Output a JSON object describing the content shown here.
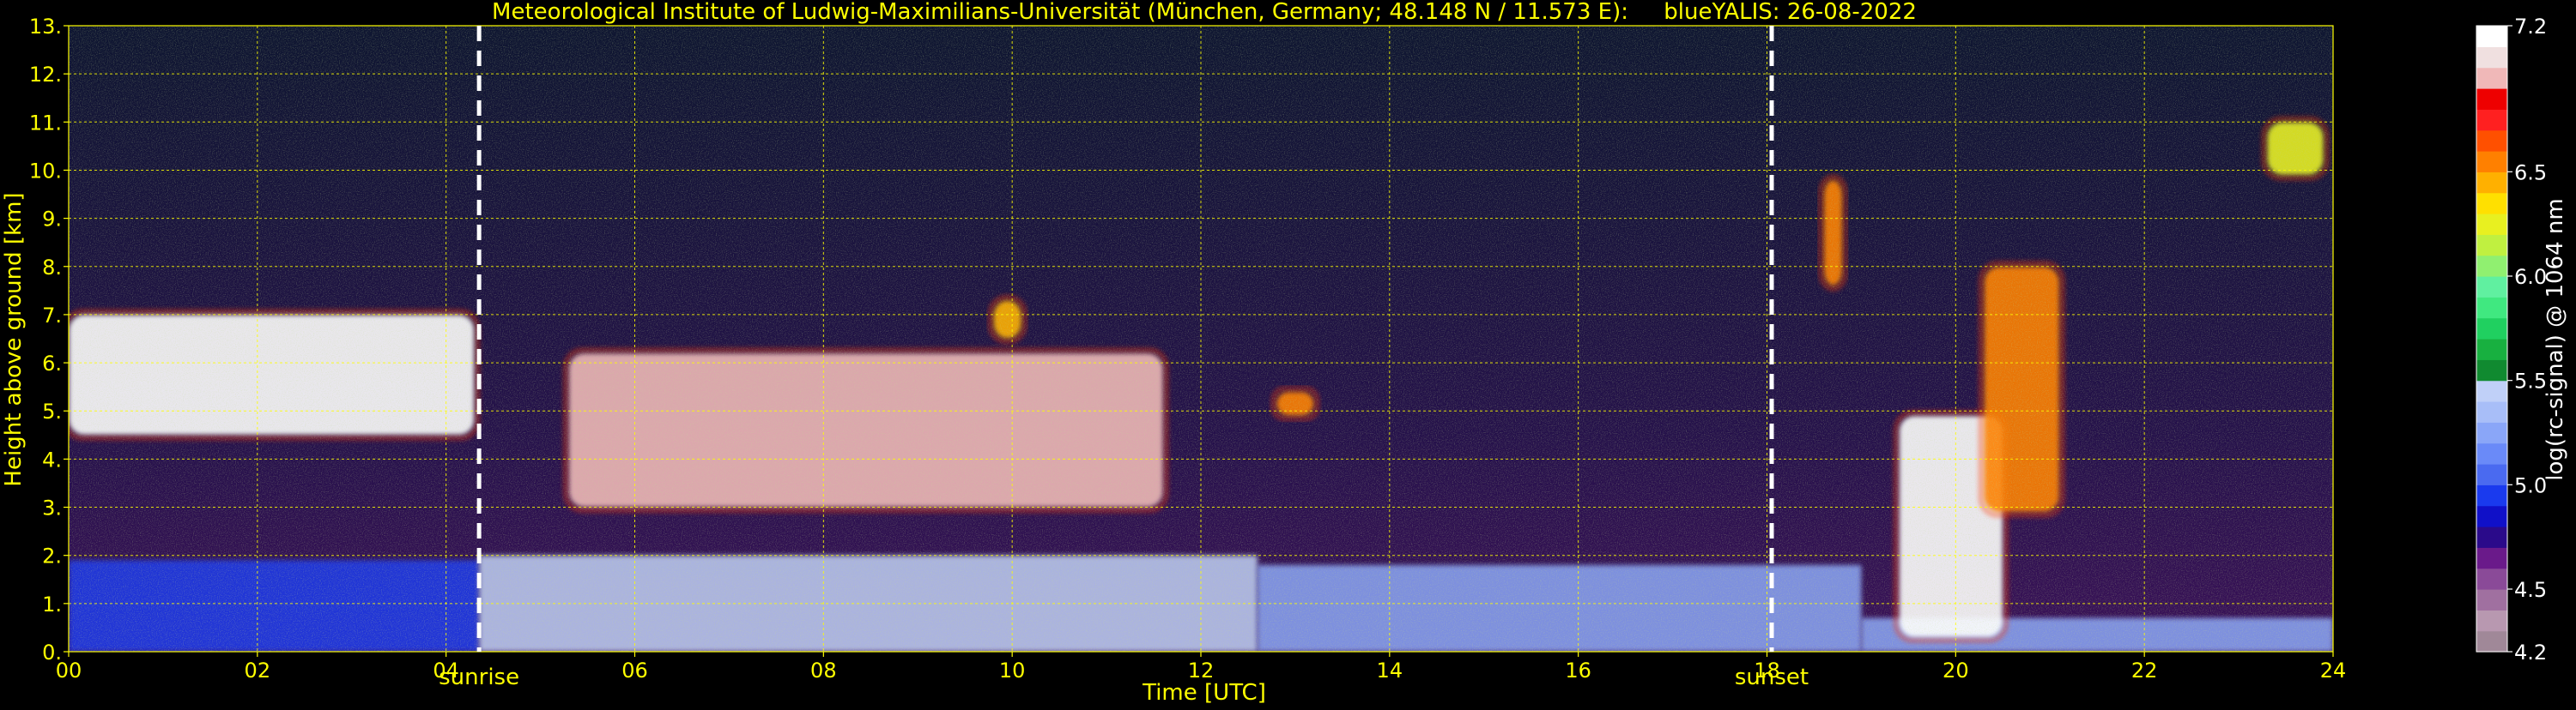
{
  "chart_data": {
    "type": "heatmap",
    "title": "Meteorological Institute of Ludwig-Maximilians-Universität (München, Germany; 48.148 N / 11.573 E):     blueYALIS: 26-08-2022",
    "xlabel": "Time [UTC]",
    "ylabel": "Height above ground [km]",
    "xlim": [
      0,
      24
    ],
    "ylim": [
      0,
      13
    ],
    "x_ticks": [
      0,
      2,
      4,
      6,
      8,
      10,
      12,
      14,
      16,
      18,
      20,
      22,
      24
    ],
    "x_tick_labels": [
      "00",
      "02",
      "04",
      "06",
      "08",
      "10",
      "12",
      "14",
      "16",
      "18",
      "20",
      "22",
      "24"
    ],
    "y_ticks": [
      0,
      1,
      2,
      3,
      4,
      5,
      6,
      7,
      8,
      9,
      10,
      11,
      12,
      13
    ],
    "y_tick_labels": [
      "0.",
      "1.",
      "2.",
      "3.",
      "4.",
      "5.",
      "6.",
      "7.",
      "8.",
      "9.",
      "10.",
      "11.",
      "12.",
      "13."
    ],
    "grid": true,
    "markers": [
      {
        "label": "sunrise",
        "x": 4.35
      },
      {
        "label": "sunset",
        "x": 18.05
      }
    ],
    "colorbar": {
      "label": "log(rc-signal) @ 1064 nm",
      "range": [
        4.2,
        7.2
      ],
      "ticks": [
        4.2,
        4.5,
        5.0,
        5.5,
        6.0,
        6.5,
        7.2
      ],
      "tick_labels": [
        "4.2",
        "4.5",
        "5.0",
        "5.5",
        "6.0",
        "6.5",
        "7.2"
      ],
      "colors": [
        "#a08898",
        "#b898b0",
        "#a070a0",
        "#8a4a98",
        "#6a1a8a",
        "#2a0a8a",
        "#1010c8",
        "#1a3aee",
        "#4a6af0",
        "#6a8af8",
        "#8aa6f8",
        "#a8bef8",
        "#c0d0f8",
        "#108a30",
        "#18b040",
        "#20d060",
        "#40e880",
        "#60f0a0",
        "#90f070",
        "#c0f040",
        "#e8f020",
        "#ffe000",
        "#ffb000",
        "#ff8000",
        "#ff5000",
        "#ff2020",
        "#ee0000",
        "#f0b8b8",
        "#f0e0e0",
        "#ffffff"
      ]
    },
    "features": [
      {
        "kind": "boundary_layer",
        "x": [
          0,
          4.35
        ],
        "height_km": [
          0.0,
          1.9
        ],
        "level": 5.0
      },
      {
        "kind": "boundary_layer",
        "x": [
          4.35,
          12.6
        ],
        "height_km": [
          0.0,
          2.0
        ],
        "level": 5.4
      },
      {
        "kind": "boundary_layer",
        "x": [
          12.6,
          19.0
        ],
        "height_km": [
          0.0,
          1.8
        ],
        "level": 5.2
      },
      {
        "kind": "boundary_layer",
        "x": [
          19.0,
          24.0
        ],
        "height_km": [
          0.0,
          0.7
        ],
        "level": 5.3
      },
      {
        "kind": "cloud_layer",
        "x": [
          0,
          4.3
        ],
        "height_km": [
          4.5,
          7.0
        ],
        "level": 7.2
      },
      {
        "kind": "cloud_layer",
        "x": [
          5.3,
          11.6
        ],
        "height_km": [
          3.0,
          6.2
        ],
        "level": 7.0
      },
      {
        "kind": "cloud",
        "x": [
          9.8,
          10.1
        ],
        "height_km": [
          6.5,
          7.3
        ],
        "level": 6.4
      },
      {
        "kind": "cloud",
        "x": [
          12.8,
          13.2
        ],
        "height_km": [
          4.9,
          5.4
        ],
        "level": 6.5
      },
      {
        "kind": "convective_cloud",
        "x": [
          19.4,
          20.5
        ],
        "height_km": [
          0.3,
          4.9
        ],
        "level": 7.2
      },
      {
        "kind": "cirrus",
        "x": [
          20.3,
          21.1
        ],
        "height_km": [
          2.9,
          8.0
        ],
        "level": 6.6
      },
      {
        "kind": "cirrus",
        "x": [
          18.6,
          18.8
        ],
        "height_km": [
          7.6,
          9.8
        ],
        "level": 6.5
      },
      {
        "kind": "cirrus",
        "x": [
          23.3,
          23.9
        ],
        "height_km": [
          9.9,
          11.0
        ],
        "level": 6.3
      }
    ]
  }
}
